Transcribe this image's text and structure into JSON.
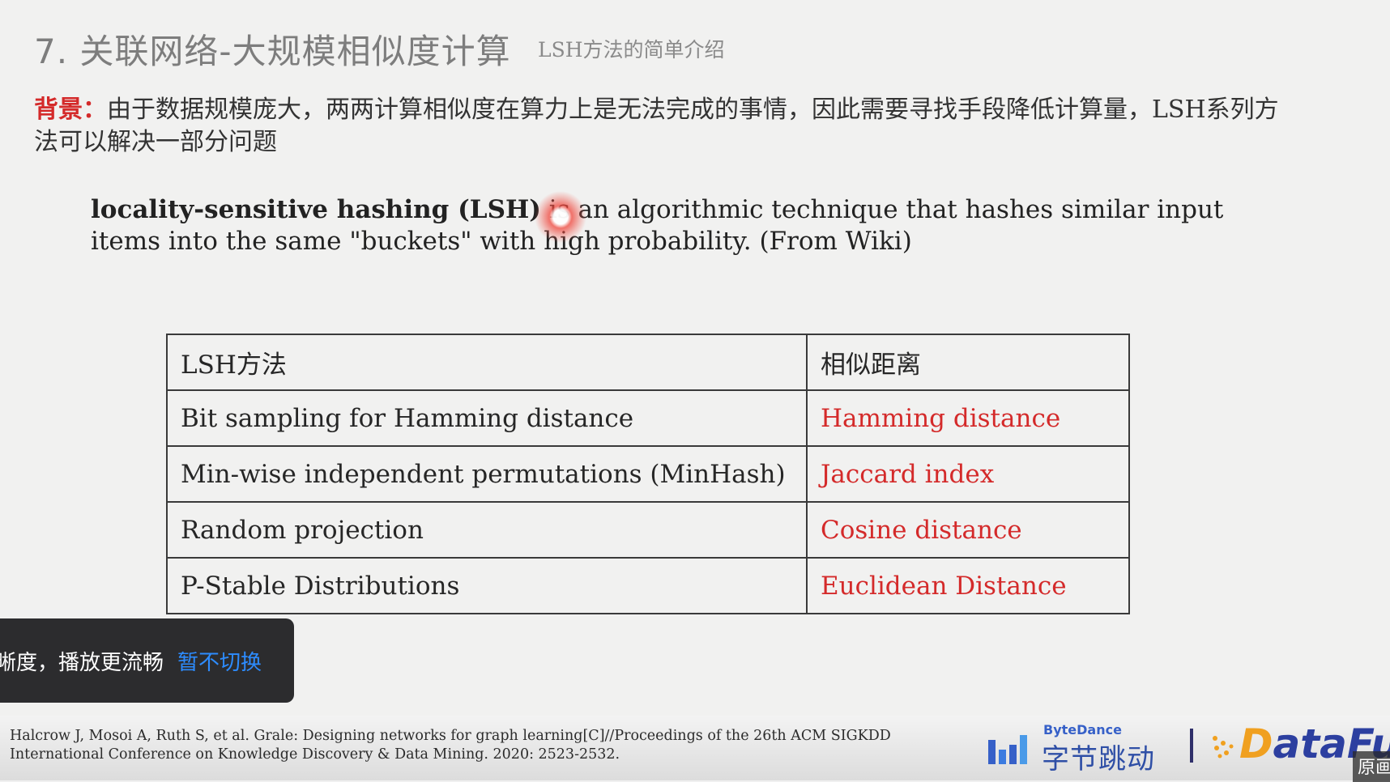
{
  "slide": {
    "title": "7. 关联网络-大规模相似度计算",
    "subtitle": "LSH方法的简单介绍",
    "background": {
      "label": "背景：",
      "text": "由于数据规模庞大，两两计算相似度在算力上是无法完成的事情，因此需要寻找手段降低计算量，LSH系列方法可以解决一部分问题"
    },
    "quote": {
      "term": "locality-sensitive hashing (LSH)",
      "text": " is an algorithmic technique that hashes similar input items into the same \"buckets\" with high probability. (From Wiki)"
    },
    "table": {
      "headers": [
        "LSH方法",
        "相似距离"
      ],
      "rows": [
        {
          "method": "Bit sampling for Hamming distance",
          "distance": "Hamming distance"
        },
        {
          "method": "Min-wise independent permutations  (MinHash)",
          "distance": "Jaccard index"
        },
        {
          "method": "Random projection",
          "distance": "Cosine distance"
        },
        {
          "method": "P-Stable Distributions",
          "distance": "Euclidean Distance"
        }
      ]
    },
    "citation": "Halcrow J, Mosoi A, Ruth S, et al. Grale: Designing networks for graph learning[C]//Proceedings of the 26th ACM SIGKDD International Conference on Knowledge Discovery & Data Mining. 2020: 2523-2532.",
    "logos": {
      "bytedance_small": "ByteDance",
      "bytedance_big": "字节跳动",
      "datafun_prefix": "D",
      "datafun_rest": "ataFun"
    }
  },
  "toast": {
    "message": "晰度，播放更流畅",
    "action": "暂不切换"
  },
  "player": {
    "corner_label": "原画"
  },
  "colors": {
    "accent_red": "#d42a2a",
    "toast_link": "#2d8cff",
    "toast_bg": "#2c2c2e"
  }
}
